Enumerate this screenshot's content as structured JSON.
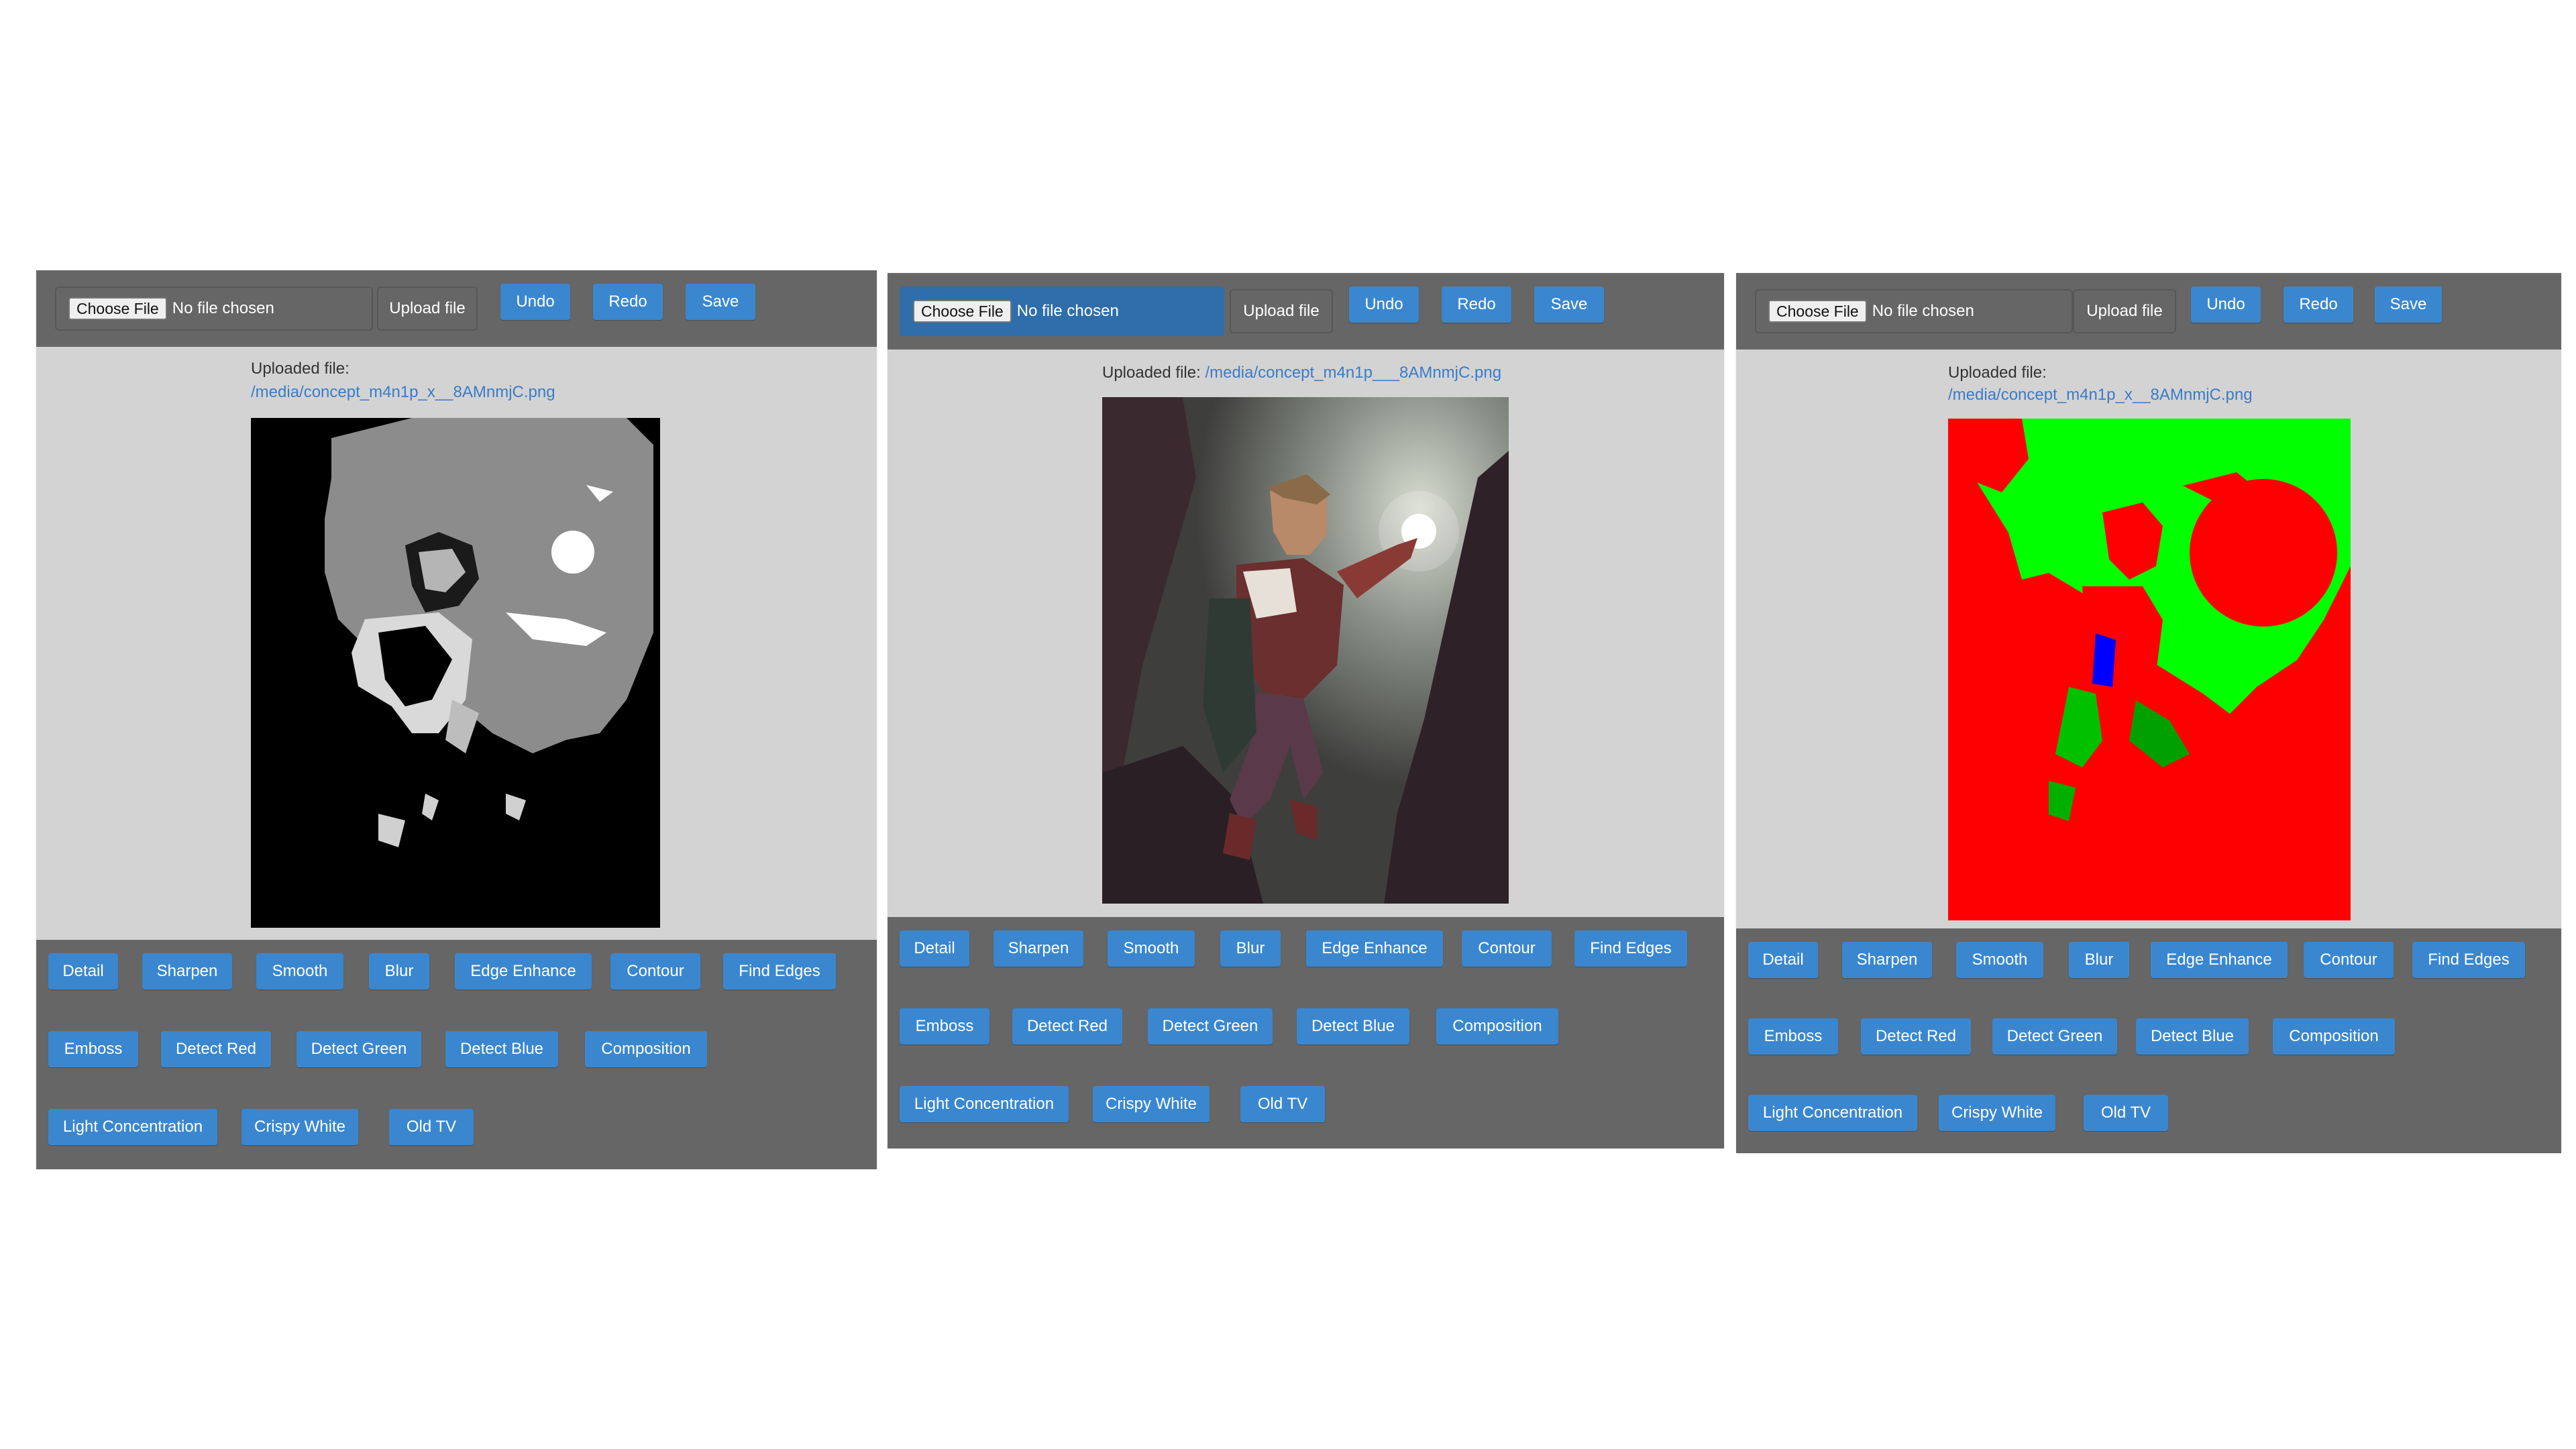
{
  "toolbar": {
    "choose_file": "Choose File",
    "no_file": "No file chosen",
    "upload": "Upload file",
    "undo": "Undo",
    "redo": "Redo",
    "save": "Save"
  },
  "uploaded_label": "Uploaded file:",
  "panels": [
    {
      "file_path": "/media/concept_m4n1p_x__8AMnmjC.png",
      "filter_view": "grayscale posterized"
    },
    {
      "file_path": "/media/concept_m4n1p___8AMnmjC.png",
      "filter_view": "original"
    },
    {
      "file_path": "/media/concept_m4n1p_x__8AMnmjC.png",
      "filter_view": "red-green-blue channel"
    }
  ],
  "filters": {
    "detail": "Detail",
    "sharpen": "Sharpen",
    "smooth": "Smooth",
    "blur": "Blur",
    "edge_enhance": "Edge Enhance",
    "contour": "Contour",
    "find_edges": "Find Edges",
    "emboss": "Emboss",
    "detect_red": "Detect Red",
    "detect_green": "Detect Green",
    "detect_blue": "Detect Blue",
    "composition": "Composition",
    "light_concentration": "Light Concentration",
    "crispy_white": "Crispy White",
    "old_tv": "Old TV"
  },
  "colors": {
    "button_blue": "#3a87cf",
    "toolbar_gray": "#666666",
    "panel_gray": "#d3d3d3",
    "link_blue": "#3a7cc7"
  }
}
